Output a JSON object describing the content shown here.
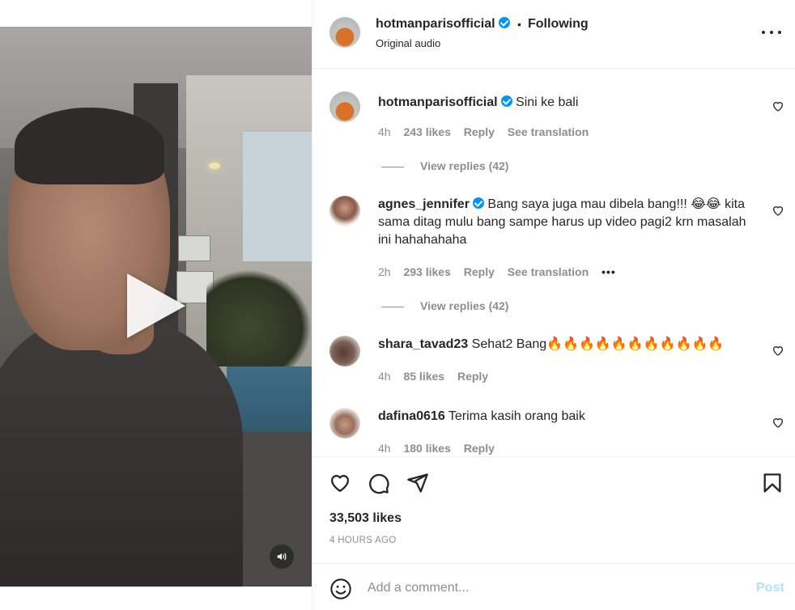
{
  "header": {
    "username": "hotmanparisofficial",
    "dot": "•",
    "follow_status": "Following",
    "subtitle": "Original audio"
  },
  "comments": [
    {
      "username": "hotmanparisofficial",
      "verified": true,
      "text": "Sini ke bali",
      "time": "4h",
      "likes": "243 likes",
      "reply": "Reply",
      "translation": "See translation",
      "view_replies": "View replies (42)"
    },
    {
      "username": "agnes_jennifer",
      "verified": true,
      "text": "Bang saya juga mau dibela bang!!! 😂😂 kita sama ditag mulu bang sampe harus up video pagi2 krn masalah ini hahahahaha",
      "time": "2h",
      "likes": "293 likes",
      "reply": "Reply",
      "translation": "See translation",
      "more": "•••",
      "view_replies": "View replies (42)"
    },
    {
      "username": "shara_tavad23",
      "verified": false,
      "text": "Sehat2 Bang🔥🔥🔥🔥🔥🔥🔥🔥🔥🔥🔥",
      "time": "4h",
      "likes": "85 likes",
      "reply": "Reply"
    },
    {
      "username": "dafina0616",
      "verified": false,
      "text": "Terima kasih orang baik",
      "time": "4h",
      "likes": "180 likes",
      "reply": "Reply"
    }
  ],
  "actions": {
    "likes_count": "33,503 likes",
    "timestamp": "4 HOURS AGO"
  },
  "comment_box": {
    "placeholder": "Add a comment...",
    "post_label": "Post"
  },
  "colors": {
    "verified": "#0095f6",
    "post_disabled": "#b2dffc",
    "secondary_text": "#8e8e8e"
  }
}
